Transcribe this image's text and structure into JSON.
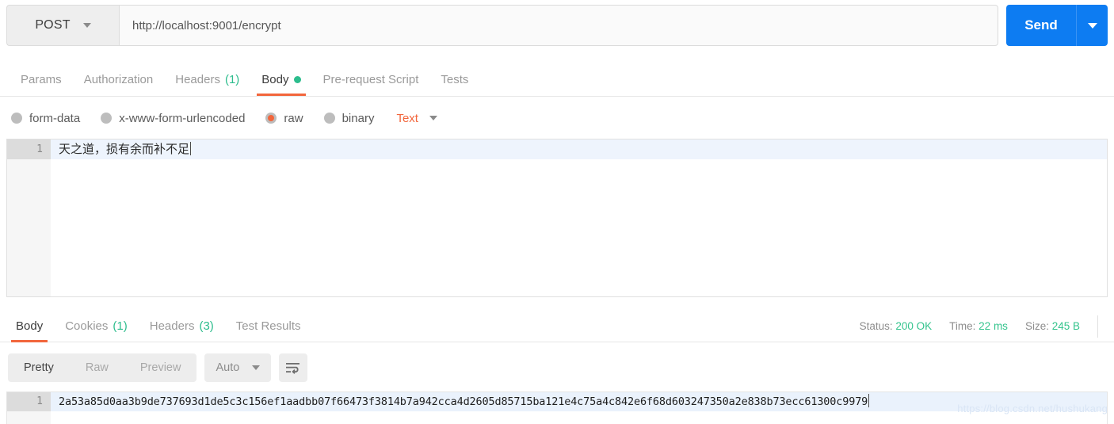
{
  "request": {
    "method": "POST",
    "url": "http://localhost:9001/encrypt",
    "send_label": "Send",
    "tabs": [
      {
        "label": "Params",
        "count": "",
        "active": false
      },
      {
        "label": "Authorization",
        "count": "",
        "active": false
      },
      {
        "label": "Headers",
        "count": "(1)",
        "active": false
      },
      {
        "label": "Body",
        "count": "",
        "active": true
      },
      {
        "label": "Pre-request Script",
        "count": "",
        "active": false
      },
      {
        "label": "Tests",
        "count": "",
        "active": false
      }
    ],
    "body_types": [
      {
        "label": "form-data",
        "selected": false
      },
      {
        "label": "x-www-form-urlencoded",
        "selected": false
      },
      {
        "label": "raw",
        "selected": true
      },
      {
        "label": "binary",
        "selected": false
      }
    ],
    "raw_format": "Text",
    "body_line_number": "1",
    "body_text": "天之道，损有余而补不足"
  },
  "response": {
    "tabs": [
      {
        "label": "Body",
        "count": "",
        "active": true
      },
      {
        "label": "Cookies",
        "count": "(1)",
        "active": false
      },
      {
        "label": "Headers",
        "count": "(3)",
        "active": false
      },
      {
        "label": "Test Results",
        "count": "",
        "active": false
      }
    ],
    "status_label": "Status:",
    "status_value": "200 OK",
    "time_label": "Time:",
    "time_value": "22 ms",
    "size_label": "Size:",
    "size_value": "245 B",
    "view_modes": [
      {
        "label": "Pretty",
        "active": true
      },
      {
        "label": "Raw",
        "active": false
      },
      {
        "label": "Preview",
        "active": false
      }
    ],
    "format_select": "Auto",
    "body_line_number": "1",
    "body_text": "2a53a85d0aa3b9de737693d1de5c3c156ef1aadbb07f66473f3814b7a942cca4d2605d85715ba121e4c75a4c842e6f68d603247350a2e838b73ecc61300c9979"
  },
  "watermark": "https://blog.csdn.net/hushukang",
  "colors": {
    "accent_orange": "#f2663c",
    "send_blue": "#0d7cf2",
    "green": "#2dbd8d",
    "status_green": "#34c48d"
  }
}
